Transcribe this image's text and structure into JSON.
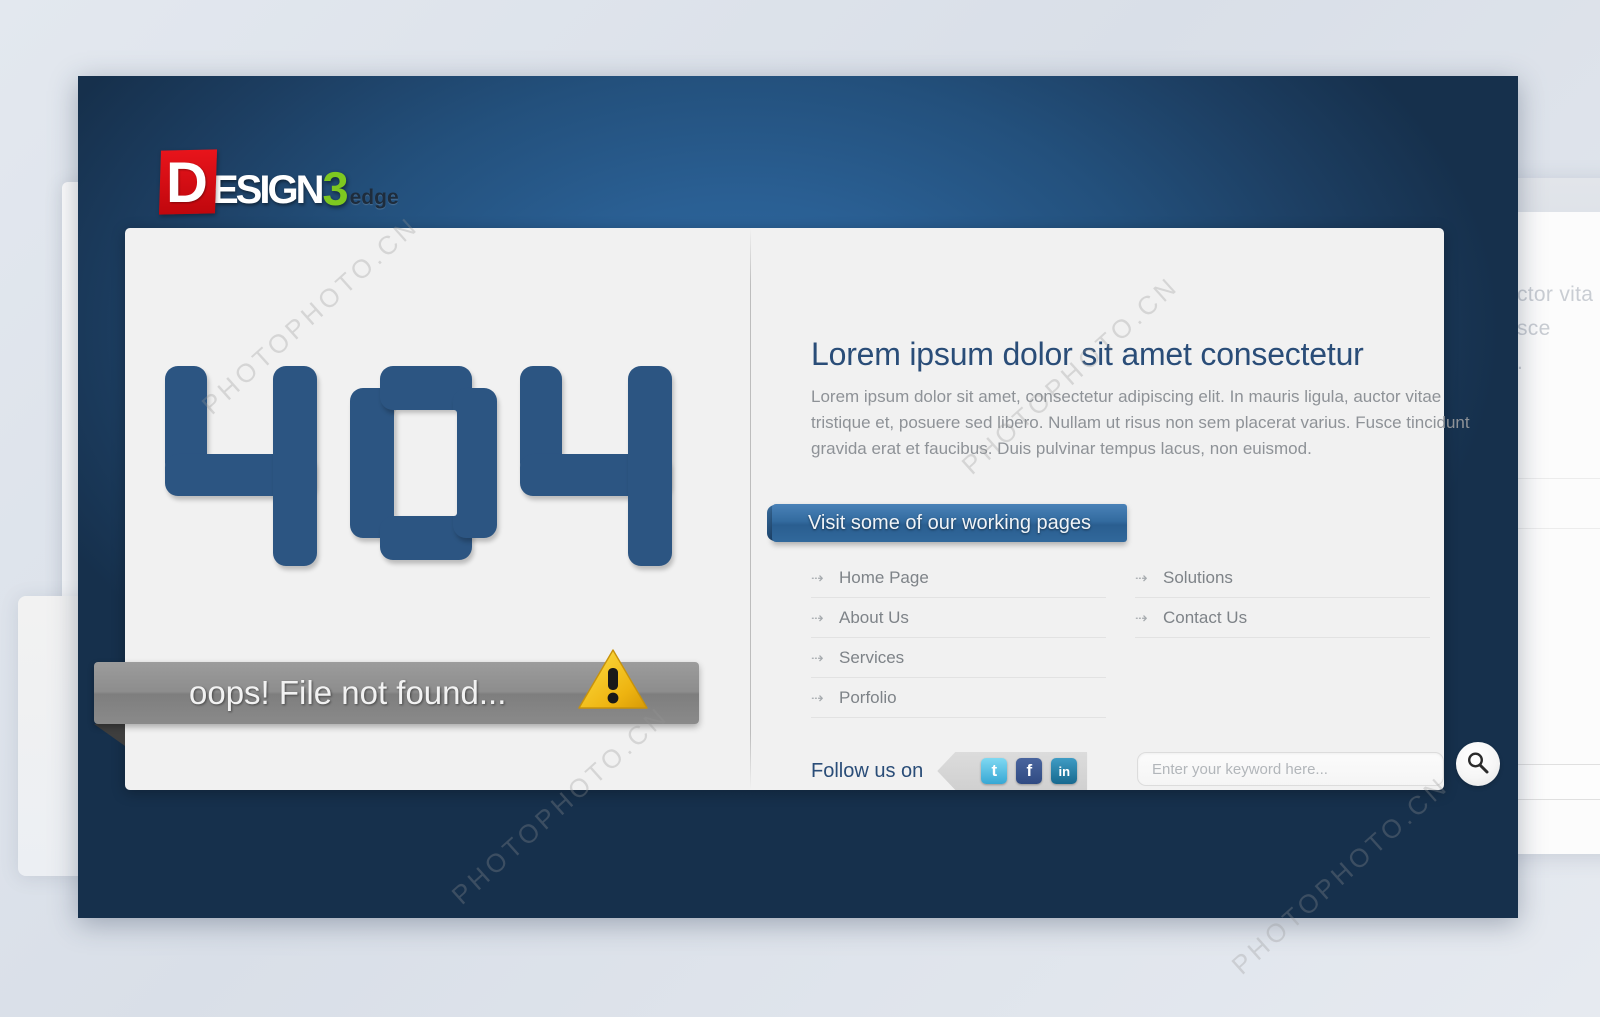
{
  "logo": {
    "d": "D",
    "esign": "ESIGN",
    "three": "3",
    "edge": "edge",
    "full": "Design3edge"
  },
  "error": {
    "code": "404",
    "message": "oops! File not found...",
    "warning_icon": "warning-triangle-icon"
  },
  "content": {
    "heading": "Lorem ipsum dolor sit amet consectetur",
    "paragraph": "Lorem ipsum dolor sit amet, consectetur adipiscing elit. In mauris ligula, auctor vitae tristique et, posuere sed libero. Nullam ut risus non sem placerat varius. Fusce tincidunt gravida erat et faucibus. Duis pulvinar tempus lacus, non euismod."
  },
  "ribbon": {
    "label": "Visit some of our working pages"
  },
  "links": {
    "arrow_glyph": "⇢",
    "column1": [
      {
        "label": "Home Page"
      },
      {
        "label": "About Us"
      },
      {
        "label": "Services"
      },
      {
        "label": "Porfolio"
      }
    ],
    "column2": [
      {
        "label": "Solutions"
      },
      {
        "label": "Contact Us"
      }
    ]
  },
  "follow": {
    "label": "Follow us on",
    "socials": [
      {
        "name": "twitter-icon",
        "glyph": "t",
        "color": "#37a7d4"
      },
      {
        "name": "facebook-icon",
        "glyph": "f",
        "color": "#2f4a82"
      },
      {
        "name": "linkedin-icon",
        "glyph": "in",
        "color": "#17698f"
      }
    ]
  },
  "search": {
    "placeholder": "Enter your keyword here...",
    "value": "",
    "button_icon": "search-icon"
  },
  "ghost": {
    "line1": "uctor vita",
    "line2": "usce",
    "line3": "d."
  },
  "watermarks": {
    "one": "PHOTOPHOTO.CN",
    "two": "PHOTOPHOTO.CN",
    "three": "PHOTOPHOTO.CN",
    "four": "PHOTOPHOTO.CN"
  },
  "colors": {
    "stage_blue": "#2a5f93",
    "stage_navy": "#16304c",
    "card_gray": "#f1f1f1",
    "num_blue": "#2c5582",
    "heading_blue": "#2a4d78",
    "ribbon_blue": "#336b9f",
    "ribbon_gray": "#8d8d8d",
    "logo_red": "#d1121a",
    "logo_green": "#7ec820",
    "warning_yellow": "#f5c518"
  }
}
